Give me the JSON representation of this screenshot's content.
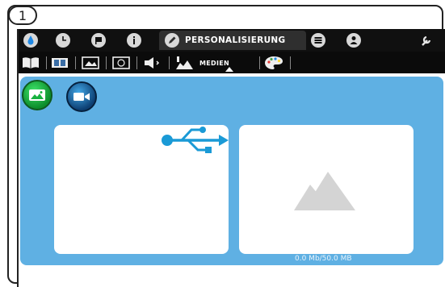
{
  "step": {
    "number": "1"
  },
  "topbar": {
    "icons": [
      "water-drop-icon",
      "clock-icon",
      "flag-icon",
      "info-icon",
      "pencil-icon",
      "stack-icon",
      "user-icon",
      "wrench-icon"
    ],
    "active_tab_label": "PERSONALISIERUNG"
  },
  "subbar": {
    "icons": [
      "open-book-icon",
      "book-icon",
      "picture-frame-icon",
      "clock-frame-icon",
      "speaker-icon",
      "image-media-icon",
      "palette-icon"
    ],
    "active_label": "MEDIEN"
  },
  "media": {
    "mode_buttons": [
      "photo-mode",
      "video-mode"
    ],
    "storage_text": "0.0 Mb/50.0 MB",
    "colors": {
      "panel": "#5fb0e3",
      "usb": "#1a9ad6",
      "photo_button": "#17b23f",
      "video_button": "#1565a8"
    }
  }
}
